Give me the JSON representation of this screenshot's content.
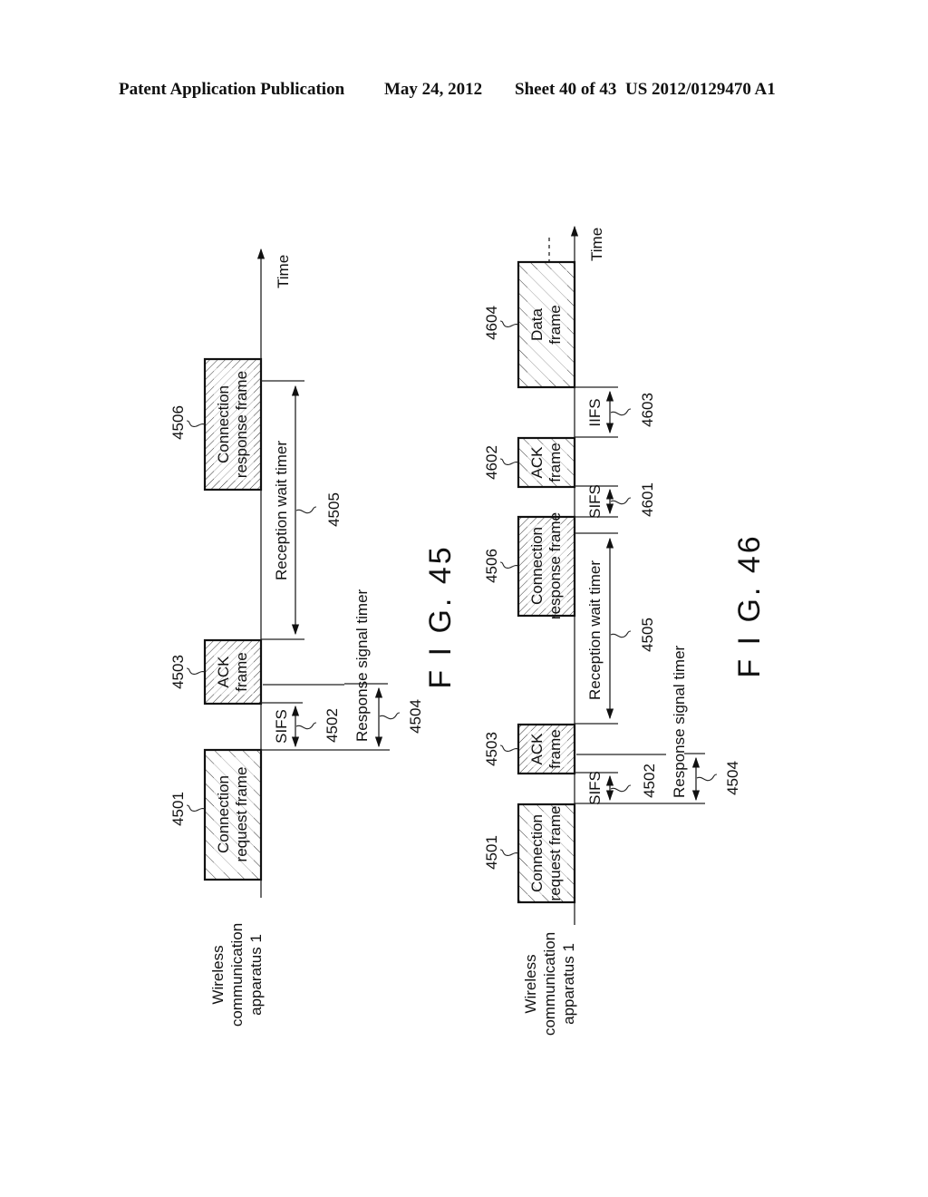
{
  "header": {
    "publication": "Patent Application Publication",
    "date": "May 24, 2012",
    "sheet": "Sheet 40 of 43",
    "number": "US 2012/0129470 A1"
  },
  "fig45": {
    "caption": "F I G. 45",
    "axis_label": "Time",
    "apparatus_label": [
      "Wireless",
      "communication",
      "apparatus 1"
    ],
    "frames": [
      {
        "ref": "4501",
        "lines": [
          "Connection",
          "request frame"
        ],
        "hatch": "sparse"
      },
      {
        "ref": "4503",
        "lines": [
          "ACK",
          "frame"
        ],
        "hatch": "dense"
      },
      {
        "ref": "4506",
        "lines": [
          "Connection",
          "response frame"
        ],
        "hatch": "dense"
      }
    ],
    "intervals": [
      {
        "ref": "4502",
        "label": "SIFS"
      },
      {
        "ref": "4504",
        "label": "Response signal timer"
      },
      {
        "ref": "4505",
        "label": "Reception wait timer"
      }
    ]
  },
  "fig46": {
    "caption": "F I G. 46",
    "axis_label": "Time",
    "continuation": "....",
    "apparatus_label": [
      "Wireless",
      "communication",
      "apparatus 1"
    ],
    "frames": [
      {
        "ref": "4501",
        "lines": [
          "Connection",
          "request frame"
        ],
        "hatch": "sparse"
      },
      {
        "ref": "4503",
        "lines": [
          "ACK",
          "frame"
        ],
        "hatch": "dense"
      },
      {
        "ref": "4506",
        "lines": [
          "Connection",
          "response frame"
        ],
        "hatch": "dense"
      },
      {
        "ref": "4602",
        "lines": [
          "ACK",
          "frame"
        ],
        "hatch": "sparse"
      },
      {
        "ref": "4604",
        "lines": [
          "Data",
          "frame"
        ],
        "hatch": "sparse"
      }
    ],
    "intervals": [
      {
        "ref": "4502",
        "label": "SIFS"
      },
      {
        "ref": "4504",
        "label": "Response signal timer"
      },
      {
        "ref": "4505",
        "label": "Reception wait timer"
      },
      {
        "ref": "4601",
        "label": "SIFS"
      },
      {
        "ref": "4603",
        "label": "IIFS"
      }
    ]
  }
}
